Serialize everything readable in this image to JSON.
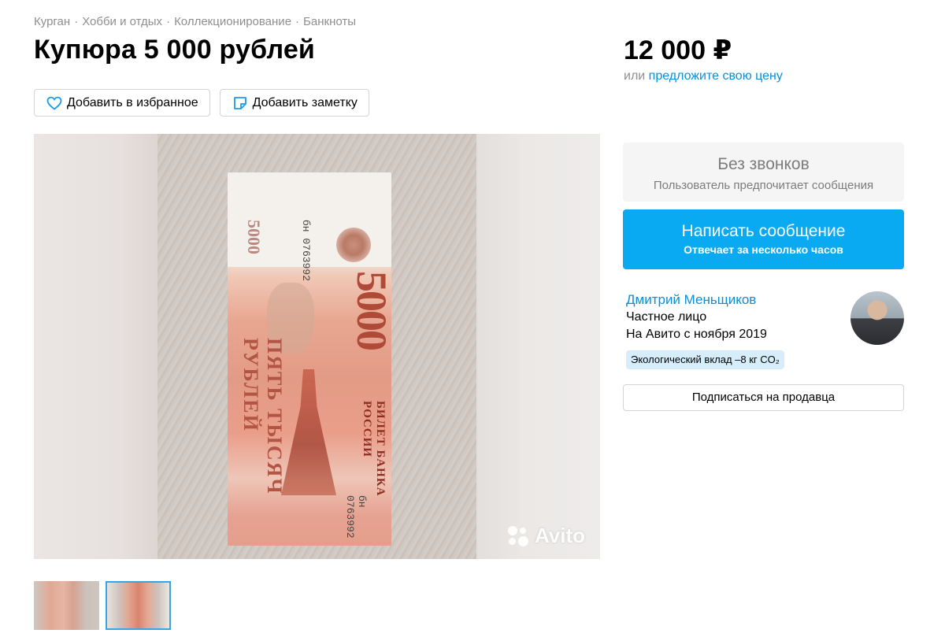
{
  "breadcrumbs": [
    "Курган",
    "Хобби и отдых",
    "Коллекционирование",
    "Банкноты"
  ],
  "breadcrumb_separator": "·",
  "title": "Купюра 5 000 рублей",
  "actions": {
    "favorite_label": "Добавить в избранное",
    "note_label": "Добавить заметку"
  },
  "gallery": {
    "watermark": "Avito",
    "thumbnails_count": 2,
    "selected_thumbnail": 2
  },
  "price": {
    "value": "12 000 ₽",
    "or_text": "или",
    "offer_link": "предложите свою цену"
  },
  "contact": {
    "no_calls_title": "Без звонков",
    "no_calls_subtitle": "Пользователь предпочитает сообщения",
    "message_button": "Написать сообщение",
    "message_subtitle": "Отвечает за несколько часов"
  },
  "seller": {
    "name": "Дмитрий Меньщиков",
    "type": "Частное лицо",
    "since": "На Авито с ноября 2019",
    "eco_badge": "Экологический вклад –8 кг CO₂",
    "subscribe_label": "Подписаться на продавца"
  },
  "colors": {
    "link": "#0a8fd6",
    "primary_button": "#0aaaf2",
    "muted_text": "#8f8f8f",
    "eco_badge_bg": "#d6eefb"
  }
}
